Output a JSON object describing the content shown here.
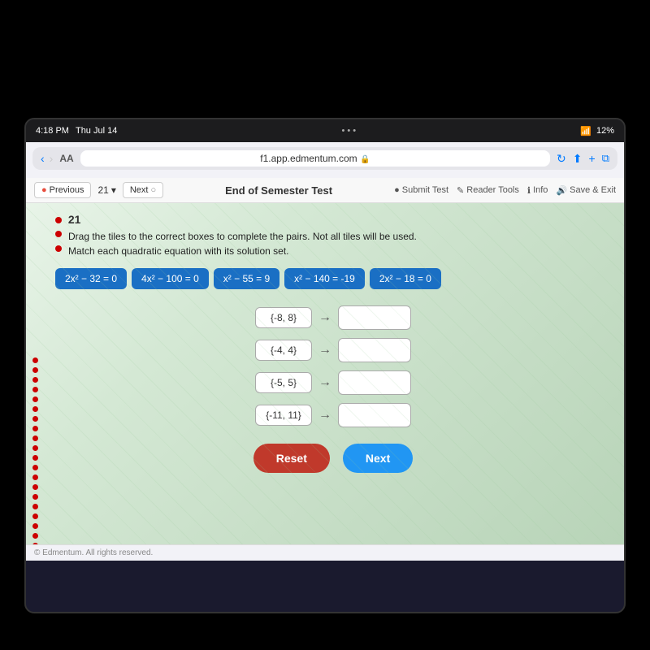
{
  "statusBar": {
    "time": "4:18 PM",
    "date": "Thu Jul 14",
    "url": "f1.app.edmentum.com",
    "battery": "12%"
  },
  "toolbar": {
    "previous_label": "Previous",
    "question_number": "21",
    "chevron": "▾",
    "next_label": "Next",
    "test_title": "End of Semester Test",
    "submit_label": "Submit Test",
    "reader_tools_label": "Reader Tools",
    "info_label": "Info",
    "save_exit_label": "Save & Exit"
  },
  "question": {
    "number": "21",
    "instruction1": "Drag the tiles to the correct boxes to complete the pairs. Not all tiles will be used.",
    "instruction2": "Match each quadratic equation with its solution set.",
    "tiles": [
      {
        "id": "t1",
        "label": "2x² − 32 = 0"
      },
      {
        "id": "t2",
        "label": "4x² − 100 = 0"
      },
      {
        "id": "t3",
        "label": "x² − 55 = 9"
      },
      {
        "id": "t4",
        "label": "x² − 140 = -19"
      },
      {
        "id": "t5",
        "label": "2x² − 18 = 0"
      }
    ],
    "solution_sets": [
      {
        "id": "s1",
        "label": "{-8, 8}"
      },
      {
        "id": "s2",
        "label": "{-4, 4}"
      },
      {
        "id": "s3",
        "label": "{-5, 5}"
      },
      {
        "id": "s4",
        "label": "{-11, 11}"
      }
    ],
    "reset_label": "Reset",
    "next_label": "Next"
  },
  "copyright": "© Edmentum. All rights reserved."
}
